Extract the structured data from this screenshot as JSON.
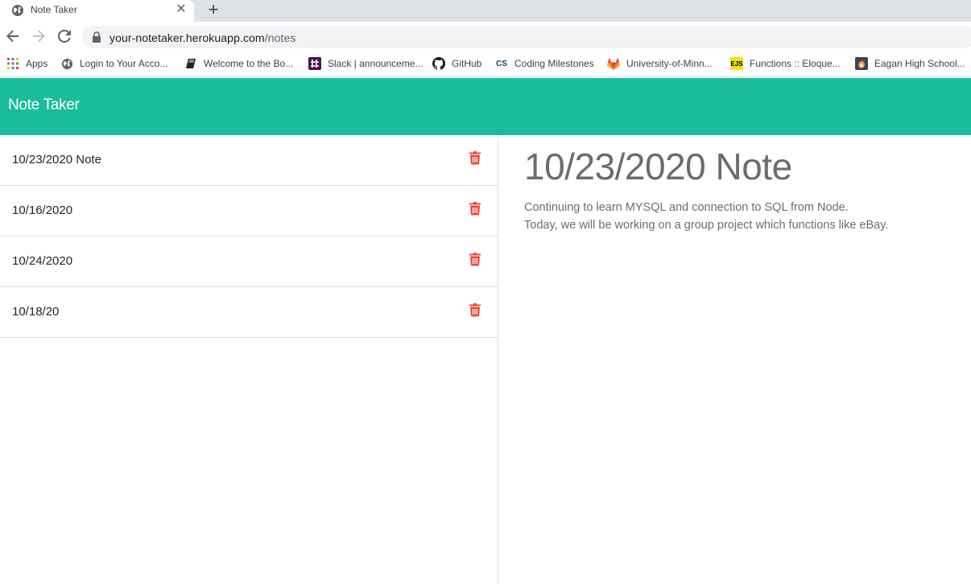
{
  "browser": {
    "tab": {
      "title": "Note Taker",
      "favicon": "globe-icon",
      "close_icon": "close-icon"
    },
    "new_tab_icon": "plus-icon",
    "nav": {
      "back_icon": "arrow-left-icon",
      "forward_icon": "arrow-right-icon",
      "reload_icon": "reload-icon"
    },
    "address": {
      "secure_icon": "lock-icon",
      "host": "your-notetaker.herokuapp.com",
      "path": "/notes"
    },
    "bookmarks": [
      {
        "label": "Apps",
        "icon": "apps-grid-icon"
      },
      {
        "label": "Login to Your Acco...",
        "icon": "globe-icon"
      },
      {
        "label": "Welcome to the Bo...",
        "icon": "book-icon"
      },
      {
        "label": "Slack | announceme...",
        "icon": "slack-icon"
      },
      {
        "label": "GitHub",
        "icon": "github-icon"
      },
      {
        "label": "Coding Milestones",
        "icon": "cs-icon",
        "icon_text": "CS"
      },
      {
        "label": "University-of-Minn...",
        "icon": "gitlab-icon"
      },
      {
        "label": "Functions :: Eloque...",
        "icon": "ejs-icon",
        "icon_text": "EJS"
      },
      {
        "label": "Eagan High School...",
        "icon": "flame-icon"
      }
    ]
  },
  "app": {
    "brand": "Note Taker",
    "colors": {
      "navbar": "#1abc9c",
      "delete": "#e74c3c",
      "note_text": "#6c6c6c"
    },
    "notes": [
      {
        "title": "10/23/2020 Note",
        "delete_icon": "trash-icon"
      },
      {
        "title": "10/16/2020",
        "delete_icon": "trash-icon"
      },
      {
        "title": "10/24/2020",
        "delete_icon": "trash-icon"
      },
      {
        "title": "10/18/20",
        "delete_icon": "trash-icon"
      }
    ],
    "active_note": {
      "title": "10/23/2020 Note",
      "text": "Continuing to learn MYSQL and connection to SQL from Node.\nToday, we will be working on a group project which functions like eBay."
    }
  }
}
